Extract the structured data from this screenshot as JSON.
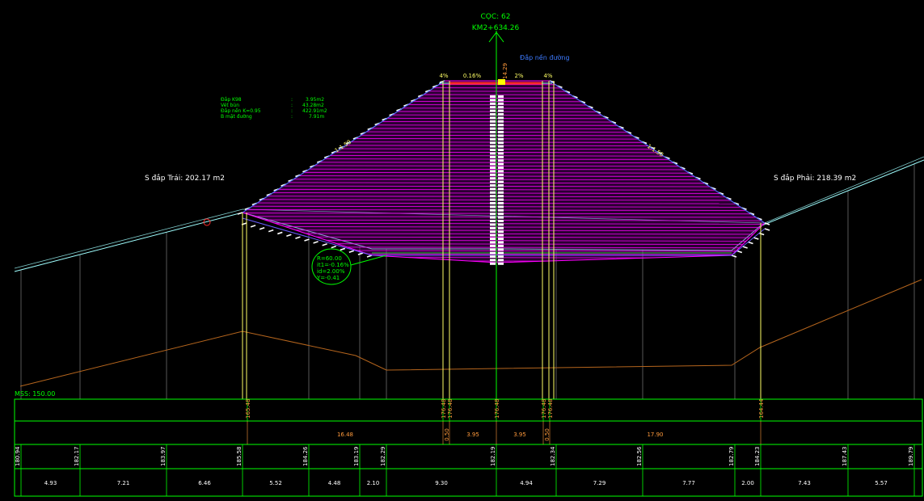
{
  "header": {
    "station": "CỌC: 62",
    "chainage": "KM2+634.26",
    "layer_label": "Đắp nền đường",
    "center_height": "14.29",
    "slopes": [
      "4%",
      "0.16%",
      "2%",
      "4%"
    ]
  },
  "quantities": {
    "labels": [
      "Đắp K98",
      "Vét bùn",
      "Đắp nền K=0.95",
      "B mặt đường"
    ],
    "values": [
      "3.95m2",
      "43.28m2",
      "422.91m2",
      "7.91m"
    ]
  },
  "areas": {
    "left": "S đắp Trái: 202.17 m2",
    "right": "S đắp Phải: 218.39 m2"
  },
  "slope_labels": {
    "left": "1:1.50",
    "right": "1:1.50"
  },
  "curve": {
    "lines": [
      "R=60.00",
      "it1=-0.16%",
      "id=2.00%",
      "Y=-0.41"
    ]
  },
  "datum": "MSS: 150.00",
  "table": {
    "design_elevations": [
      "165.48",
      "176.48",
      "176.48",
      "176.48",
      "176.48",
      "176.48",
      "164.44"
    ],
    "design_distances": [
      "16.48",
      "0.50",
      "3.95",
      "3.95",
      "0.50",
      "17.90"
    ],
    "natural_elevations": [
      "180.94",
      "182.17",
      "183.97",
      "185.58",
      "184.26",
      "183.19",
      "182.29",
      "182.19",
      "182.34",
      "182.56",
      "182.79",
      "184.23",
      "187.43",
      "189.79"
    ],
    "natural_distances": [
      "4.93",
      "7.21",
      "6.46",
      "5.52",
      "4.48",
      "2.10",
      "9.30",
      "4.94",
      "7.29",
      "7.77",
      "2.00",
      "7.43",
      "5.57"
    ]
  },
  "colors": {
    "background": "#000000",
    "frame": "#00ff00",
    "ground": "#9fffff",
    "fill": "#ff00ff",
    "road": "#ff2a2a",
    "text": "#ffffff",
    "stakes": "#ffff66",
    "natural": "#b5651d",
    "elevation_text": "#ff9a3c"
  }
}
